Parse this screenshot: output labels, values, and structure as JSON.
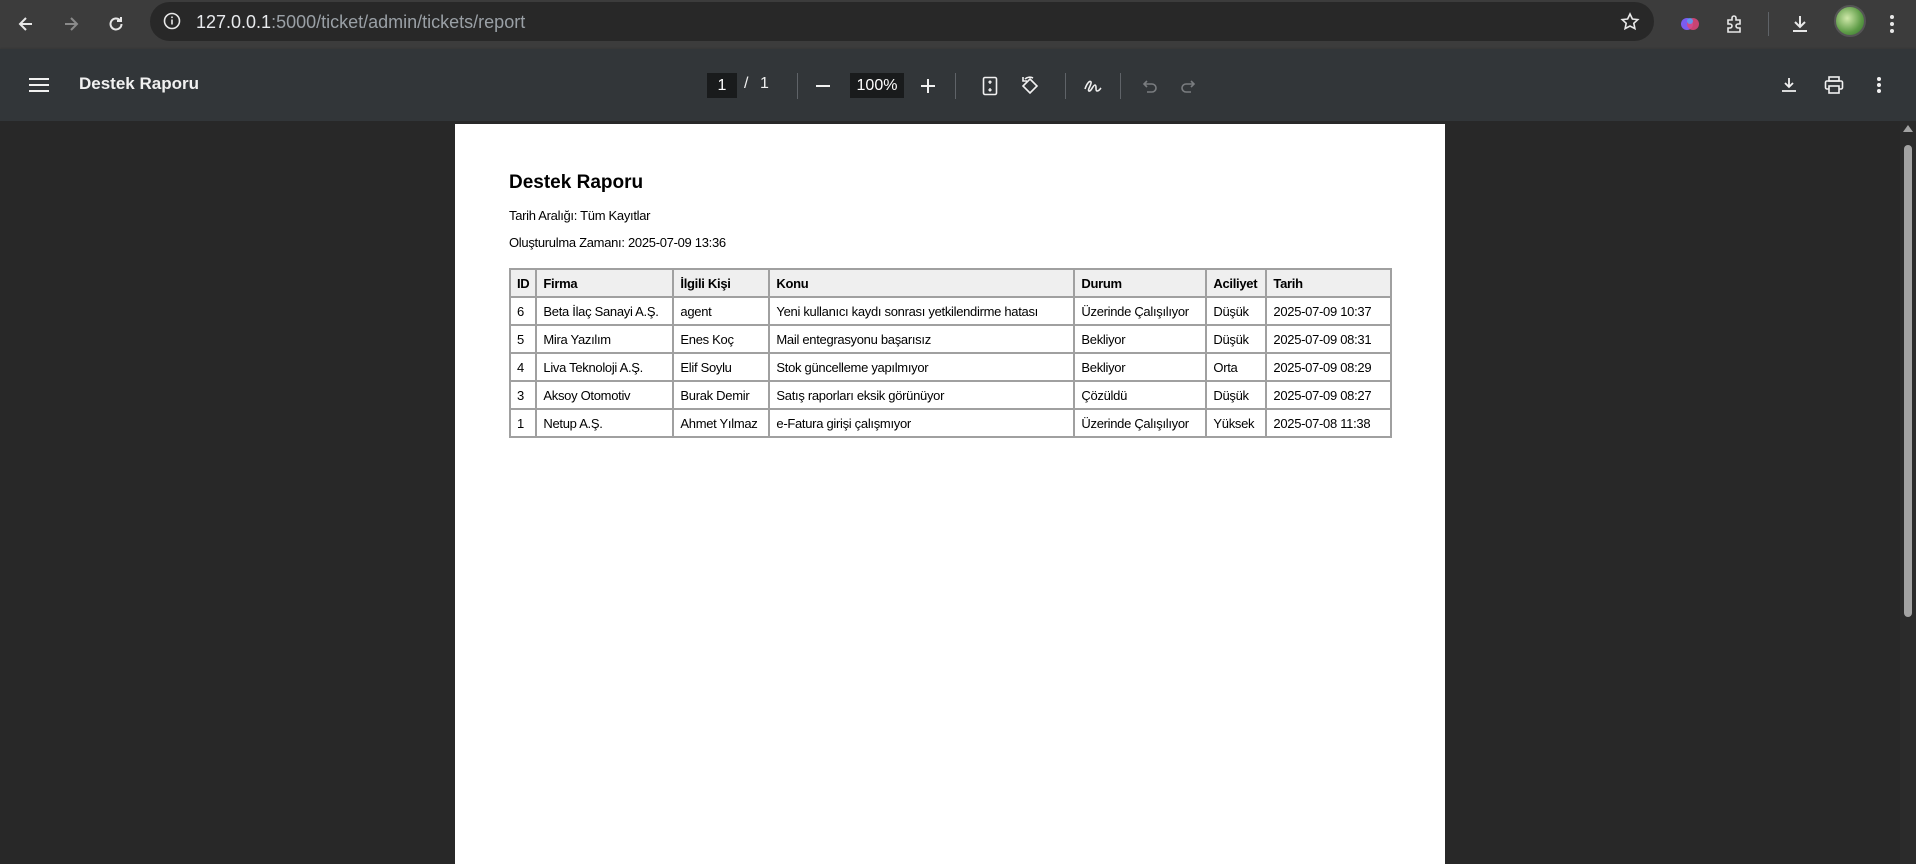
{
  "browser": {
    "url_host": "127.0.0.1",
    "url_rest": ":5000/ticket/admin/tickets/report"
  },
  "pdf_viewer": {
    "title": "Destek Raporu",
    "page_current": "1",
    "page_separator": "/",
    "page_total": "1",
    "zoom": "100%"
  },
  "document": {
    "title": "Destek Raporu",
    "date_range": "Tarih Aralığı: Tüm Kayıtlar",
    "generated_at": "Oluşturulma Zamanı: 2025-07-09 13:36",
    "table": {
      "headers": [
        "ID",
        "Firma",
        "İlgili Kişi",
        "Konu",
        "Durum",
        "Aciliyet",
        "Tarih"
      ],
      "rows": [
        [
          "6",
          "Beta İlaç Sanayi A.Ş.",
          "agent",
          "Yeni kullanıcı kaydı sonrası yetkilendirme hatası",
          "Üzerinde Çalışılıyor",
          "Düşük",
          "2025-07-09 10:37"
        ],
        [
          "5",
          "Mira Yazılım",
          "Enes Koç",
          "Mail entegrasyonu başarısız",
          "Bekliyor",
          "Düşük",
          "2025-07-09 08:31"
        ],
        [
          "4",
          "Liva Teknoloji A.Ş.",
          "Elif Soylu",
          "Stok güncelleme yapılmıyor",
          "Bekliyor",
          "Orta",
          "2025-07-09 08:29"
        ],
        [
          "3",
          "Aksoy Otomotiv",
          "Burak Demir",
          "Satış raporları eksik görünüyor",
          "Çözüldü",
          "Düşük",
          "2025-07-09 08:27"
        ],
        [
          "1",
          "Netup A.Ş.",
          "Ahmet Yılmaz",
          "e-Fatura girişi çalışmıyor",
          "Üzerinde Çalışılıyor",
          "Yüksek",
          "2025-07-08 11:38"
        ]
      ]
    }
  },
  "colors": {
    "chrome_bar": "#3c3c3c",
    "omnibox": "#282828",
    "pdf_toolbar": "#323639",
    "viewer_bg": "#282828",
    "table_header_bg": "#efefef",
    "table_border": "#a0a0a0"
  },
  "icons": [
    "back-arrow-icon",
    "forward-arrow-icon",
    "reload-icon",
    "site-info-icon",
    "bookmark-star-icon",
    "gemini-icon",
    "extensions-icon",
    "downloads-icon",
    "chrome-menu-icon",
    "sidebar-menu-icon",
    "zoom-out-icon",
    "zoom-in-icon",
    "fit-page-icon",
    "rotate-icon",
    "annotate-icon",
    "undo-icon",
    "redo-icon",
    "pdf-download-icon",
    "print-icon",
    "pdf-more-icon"
  ]
}
